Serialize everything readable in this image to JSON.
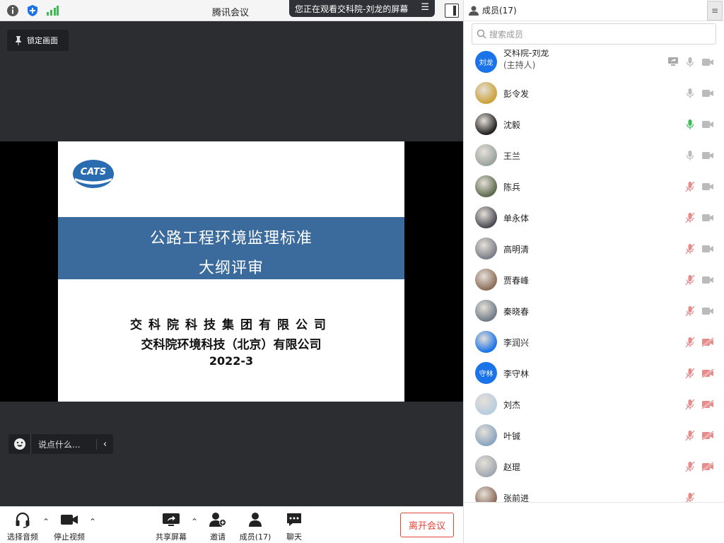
{
  "titlebar": {
    "title": "腾讯会议",
    "share_notice": "您正在观看交科院-刘龙的屏幕"
  },
  "stage": {
    "lock_label": "锁定画面",
    "chat_placeholder": "说点什么..."
  },
  "slide": {
    "title_line1": "公路工程环境监理标准",
    "title_line2": "大纲评审",
    "org_line1": "交科院科技集团有限公司",
    "org_line2": "交科院环境科技（北京）有限公司",
    "date": "2022-3"
  },
  "toolbar": {
    "audio_label": "选择音频",
    "video_label": "停止视频",
    "share_label": "共享屏幕",
    "invite_label": "邀请",
    "members_label": "成员(17)",
    "chat_label": "聊天",
    "leave_label": "离开会议"
  },
  "panel": {
    "header": "成员(17)",
    "search_placeholder": "搜索成员",
    "members": [
      {
        "name": "交科院-刘龙",
        "role": "(主持人)",
        "avatar_text": "刘龙",
        "mic": "muted-grey",
        "cam": "off-grey",
        "sharing": true
      },
      {
        "name": "彭令发",
        "mic": "grey",
        "cam": "off-grey"
      },
      {
        "name": "沈毅",
        "mic": "active-green",
        "cam": "off-grey"
      },
      {
        "name": "王兰",
        "mic": "grey",
        "cam": "off-grey"
      },
      {
        "name": "陈兵",
        "mic": "muted-red",
        "cam": "off-grey"
      },
      {
        "name": "单永体",
        "mic": "muted-red",
        "cam": "off-grey"
      },
      {
        "name": "高明清",
        "mic": "muted-red",
        "cam": "off-grey"
      },
      {
        "name": "贾春峰",
        "mic": "muted-red",
        "cam": "off-grey"
      },
      {
        "name": "秦晓春",
        "mic": "muted-red",
        "cam": "off-grey"
      },
      {
        "name": "李润兴",
        "mic": "muted-red",
        "cam": "off-red"
      },
      {
        "name": "李守林",
        "avatar_text": "守林",
        "mic": "muted-red",
        "cam": "off-red"
      },
      {
        "name": "刘杰",
        "mic": "muted-red",
        "cam": "off-red"
      },
      {
        "name": "叶铖",
        "mic": "muted-red",
        "cam": "off-red"
      },
      {
        "name": "赵琨",
        "mic": "muted-red",
        "cam": "off-red"
      },
      {
        "name": "张前进",
        "mic": "muted-red"
      }
    ]
  },
  "colors": {
    "accent_blue": "#1a73e8",
    "leave_red": "#e0463a",
    "muted_red": "#e88b8b",
    "active_green": "#3cba54",
    "slide_band": "#3a6b9c"
  }
}
